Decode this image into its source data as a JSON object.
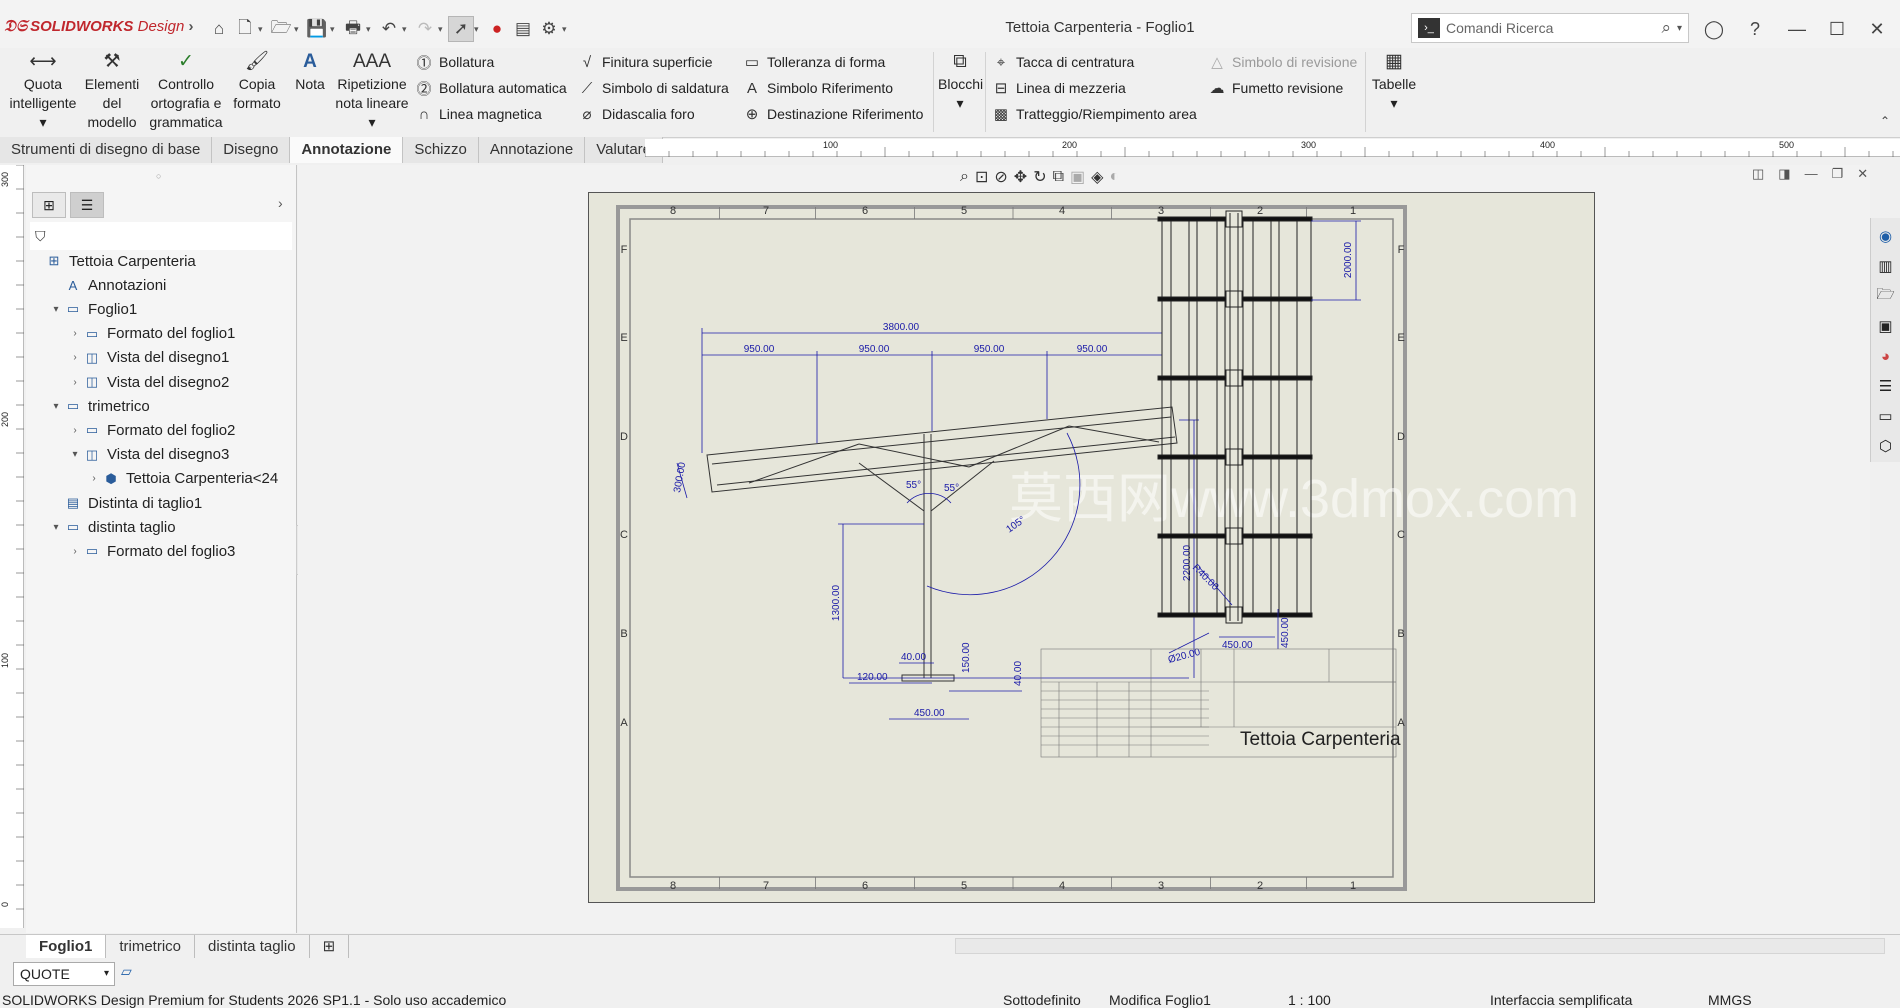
{
  "app": {
    "logo": "SOLIDWORKS",
    "logo_suffix": "Design",
    "title": "Tettoia Carpenteria - Foglio1"
  },
  "search": {
    "placeholder": "Comandi Ricerca"
  },
  "ribbon": {
    "big": [
      "Quota intelligente",
      "Elementi del modello",
      "Controllo ortografia e grammatica",
      "Copia formato",
      "Nota",
      "Ripetizione nota lineare"
    ],
    "col1": [
      "Bollatura",
      "Bollatura automatica",
      "Linea magnetica"
    ],
    "col2": [
      "Finitura superficie",
      "Simbolo di saldatura",
      "Didascalia foro"
    ],
    "col3": [
      "Tolleranza di forma",
      "Simbolo Riferimento",
      "Destinazione Riferimento"
    ],
    "blocchi": "Blocchi",
    "col4": [
      "Tacca di centratura",
      "Linea di mezzeria",
      "Tratteggio/Riempimento area"
    ],
    "col5": [
      "Simbolo di revisione",
      "Fumetto revisione"
    ],
    "tabelle": "Tabelle"
  },
  "tabs": [
    "Strumenti di disegno di base",
    "Disegno",
    "Annotazione",
    "Schizzo",
    "Annotazione",
    "Valutare"
  ],
  "ruler": {
    "h": [
      "100",
      "200",
      "300",
      "400",
      "500"
    ],
    "v": [
      "300",
      "200",
      "100",
      "0"
    ]
  },
  "tree": [
    {
      "label": "Tettoia Carpenteria",
      "level": 0,
      "icon": "drawing-icon",
      "exp": ""
    },
    {
      "label": "Annotazioni",
      "level": 1,
      "icon": "annotation-icon",
      "exp": ""
    },
    {
      "label": "Foglio1",
      "level": 1,
      "icon": "sheet-icon",
      "exp": "open"
    },
    {
      "label": "Formato del foglio1",
      "level": 2,
      "icon": "sheet-format-icon",
      "exp": "closed"
    },
    {
      "label": "Vista del disegno1",
      "level": 2,
      "icon": "view-icon",
      "exp": "closed"
    },
    {
      "label": "Vista del disegno2",
      "level": 2,
      "icon": "view-icon",
      "exp": "closed"
    },
    {
      "label": "trimetrico",
      "level": 1,
      "icon": "sheet-icon",
      "exp": "open"
    },
    {
      "label": "Formato del foglio2",
      "level": 2,
      "icon": "sheet-format-icon",
      "exp": "closed"
    },
    {
      "label": "Vista del disegno3",
      "level": 2,
      "icon": "view-icon",
      "exp": "open"
    },
    {
      "label": "Tettoia Carpenteria<24",
      "level": 3,
      "icon": "part-icon",
      "exp": "closed"
    },
    {
      "label": "Distinta di taglio1",
      "level": 1,
      "icon": "cutlist-icon",
      "exp": ""
    },
    {
      "label": "distinta taglio",
      "level": 1,
      "icon": "sheet-icon",
      "exp": "open"
    },
    {
      "label": "Formato del foglio3",
      "level": 2,
      "icon": "sheet-format-icon",
      "exp": "closed"
    }
  ],
  "drawing": {
    "zones_h": [
      "8",
      "7",
      "6",
      "5",
      "4",
      "3",
      "2",
      "1"
    ],
    "zones_v": [
      "F",
      "E",
      "D",
      "C",
      "B",
      "A"
    ],
    "dims": {
      "total": "3800.00",
      "seg": "950.00",
      "h2200": "2200.00",
      "h1300": "1300.00",
      "d40": "40.00",
      "d120": "120.00",
      "d150": "150.00",
      "d450": "450.00",
      "d40b": "40.00",
      "d300": "300.00",
      "a55a": "55°",
      "a55b": "55°",
      "a105": "105°",
      "d2000": "2000.00",
      "r40": "R40.00",
      "phi20": "Ø20.00",
      "p450a": "450.00",
      "p450b": "450.00"
    },
    "title": "Tettoia Carpenteria",
    "watermark": "莫西网www.3dmox.com"
  },
  "bottom_tabs": [
    "Foglio1",
    "trimetrico",
    "distinta taglio"
  ],
  "command_combo": "QUOTE",
  "status": {
    "product": "SOLIDWORKS Design Premium for Students 2026 SP1.1 - Solo uso accademico",
    "state": "Sottodefinito",
    "edit": "Modifica Foglio1",
    "scale": "1 : 100",
    "ui": "Interfaccia semplificata",
    "units": "MMGS"
  },
  "colors": {
    "dim": "#1a1aa8",
    "sheet": "#e6e6da",
    "accent": "#c0272d"
  }
}
